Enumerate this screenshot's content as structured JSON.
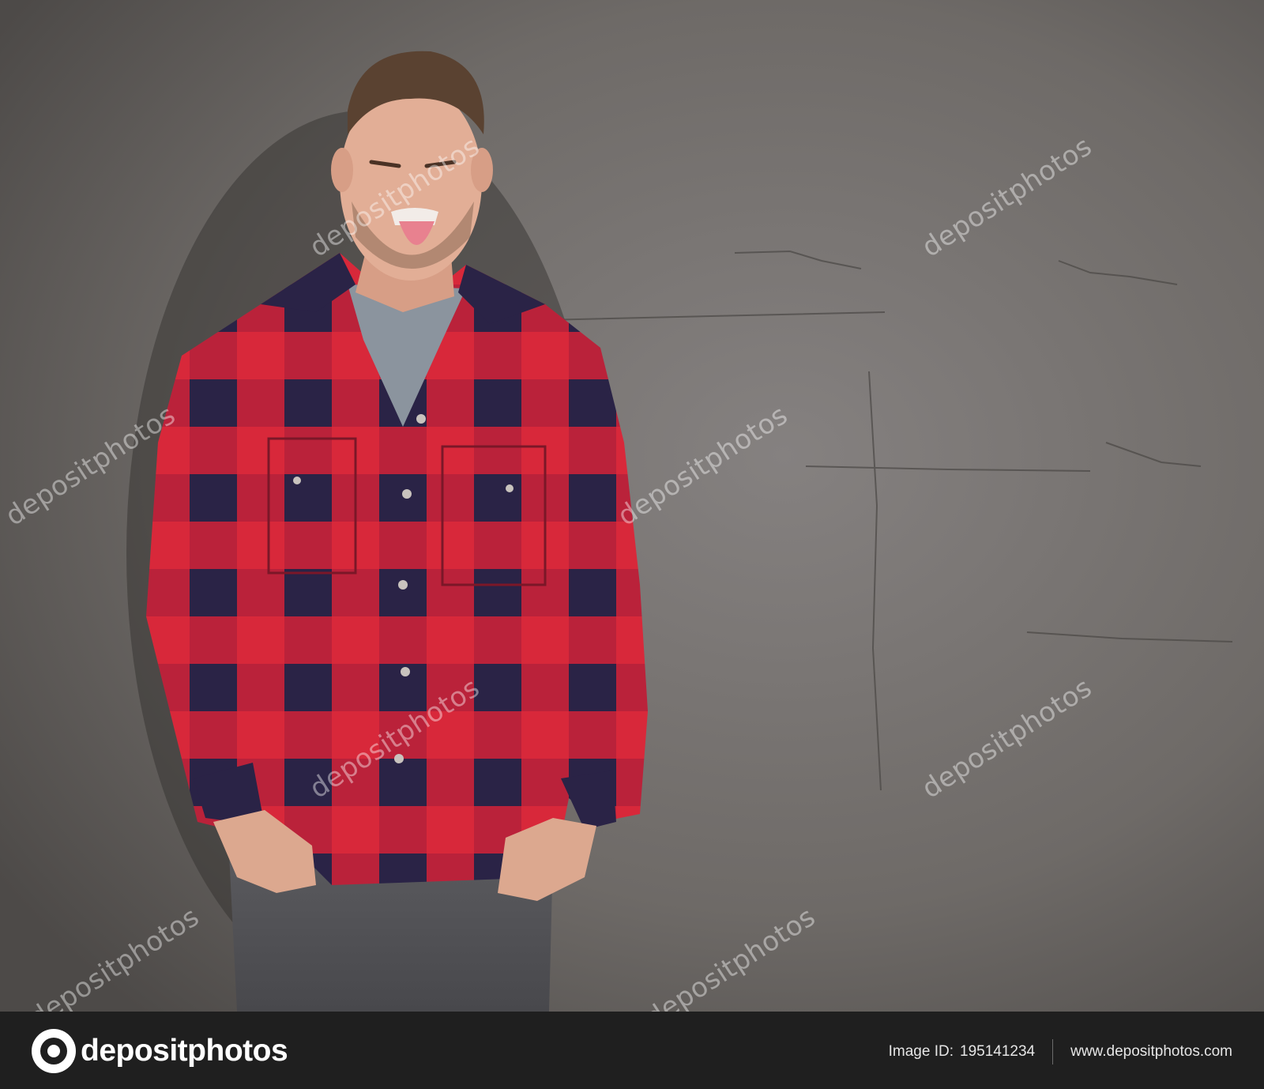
{
  "photo": {
    "subject": "young-man-plaid-shirt-tongue-out",
    "background": "grey-concrete-wall",
    "watermark_text": "depositphotos"
  },
  "footer": {
    "logo_text": "depositphotos",
    "image_id_label": "Image ID:",
    "image_id": "195141234",
    "website": "www.depositphotos.com"
  },
  "colors": {
    "shirt_red": "#d8283a",
    "shirt_navy": "#2a2346",
    "wall": "#6f6b68",
    "footer_bg": "#1f1f1f"
  }
}
